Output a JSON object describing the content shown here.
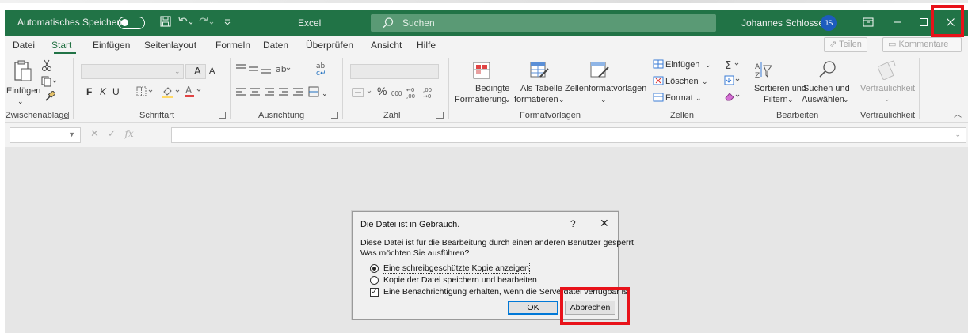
{
  "window": {
    "autosave_label": "Automatisches Speichern",
    "app_name": "Excel",
    "search_placeholder": "Suchen",
    "user_name": "Johannes Schlosser",
    "user_initials": "JS",
    "accent": "#217346",
    "highlight_color": "#e8121a"
  },
  "menu": {
    "tabs": [
      "Datei",
      "Start",
      "Einfügen",
      "Seitenlayout",
      "Formeln",
      "Daten",
      "Überprüfen",
      "Ansicht",
      "Hilfe"
    ],
    "active_tab": "Start",
    "share_label": "Teilen",
    "comment_label": "Kommentare"
  },
  "ribbon": {
    "clipboard": {
      "paste_label": "Einfügen",
      "group": "Zwischenablage"
    },
    "font": {
      "bold": "F",
      "italic": "K",
      "underline": "U",
      "grow": "A",
      "group": "Schriftart"
    },
    "alignment": {
      "group": "Ausrichtung"
    },
    "number": {
      "percent": "%",
      "thousands": "000",
      "group": "Zahl"
    },
    "styles": {
      "conditional_line1": "Bedingte",
      "conditional_line2": "Formatierung",
      "table_line1": "Als Tabelle",
      "table_line2": "formatieren",
      "cell_styles": "Zellenformatvorlagen",
      "group": "Formatvorlagen"
    },
    "cells": {
      "insert": "Einfügen",
      "delete": "Löschen",
      "format": "Format",
      "group": "Zellen"
    },
    "editing": {
      "sort_line1": "Sortieren und",
      "sort_line2": "Filtern",
      "find_line1": "Suchen und",
      "find_line2": "Auswählen",
      "group": "Bearbeiten"
    },
    "sensitivity": {
      "label": "Vertraulichkeit",
      "group": "Vertraulichkeit"
    }
  },
  "formula_bar": {
    "fx": "fx"
  },
  "dialog": {
    "title": "Die Datei ist in Gebrauch.",
    "help": "?",
    "close": "✕",
    "message_line1": "Diese Datei ist für die Bearbeitung durch einen anderen Benutzer gesperrt.",
    "message_line2": "Was möchten Sie ausführen?",
    "option_readonly": "Eine schreibgeschützte Kopie anzeigen",
    "option_save_copy": "Kopie der Datei speichern und bearbeiten",
    "option_notify": "Eine Benachrichtigung erhalten, wenn die Serverdatei verfügbar ist",
    "ok_label": "OK",
    "cancel_label": "Abbrechen"
  }
}
